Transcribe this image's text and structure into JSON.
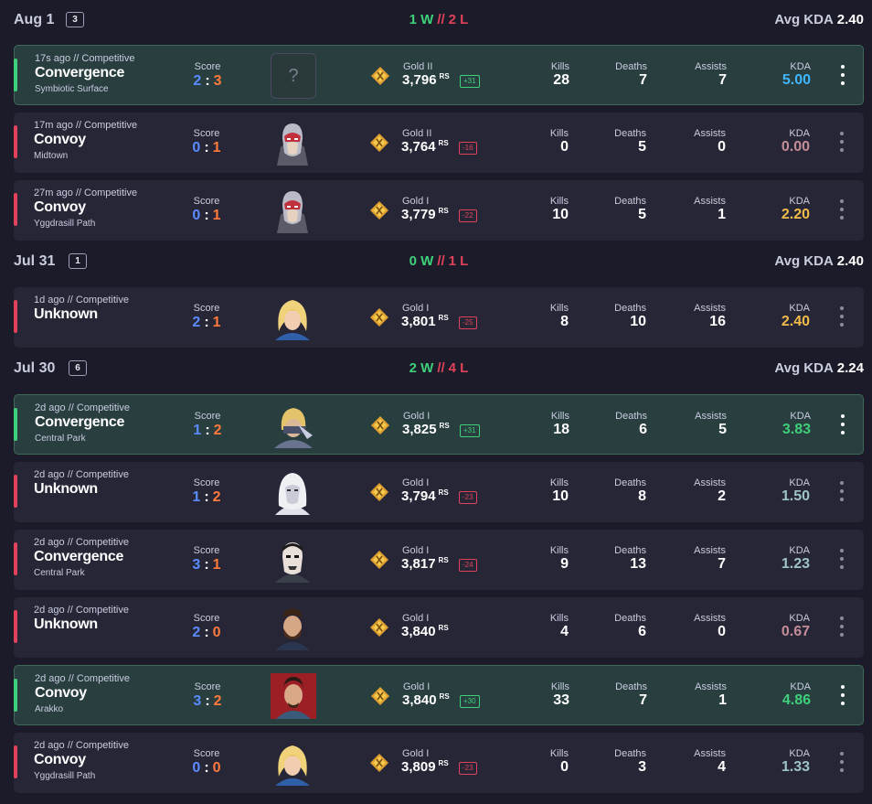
{
  "groups": [
    {
      "date": "Aug 1",
      "count": "3",
      "wins": "1 W",
      "sep": "//",
      "losses": "2 L",
      "avg_kda_label": "Avg KDA",
      "avg_kda": "2.40"
    },
    {
      "date": "Jul 31",
      "count": "1",
      "wins": "0 W",
      "sep": "//",
      "losses": "1 L",
      "avg_kda_label": "Avg KDA",
      "avg_kda": "2.40"
    },
    {
      "date": "Jul 30",
      "count": "6",
      "wins": "2 W",
      "sep": "//",
      "losses": "4 L",
      "avg_kda_label": "Avg KDA",
      "avg_kda": "2.24"
    }
  ],
  "labels": {
    "score": "Score",
    "kills": "Kills",
    "deaths": "Deaths",
    "assists": "Assists",
    "kda": "KDA",
    "rs": "RS",
    "unknown_hero": "?"
  },
  "matches": [
    {
      "meta": "17s ago  //  Competitive",
      "mode": "Convergence",
      "map": "Symbiotic Surface",
      "score_a": "2",
      "score_b": "3",
      "rank": "Gold II",
      "points": "3,796",
      "delta": "+31",
      "kills": "28",
      "deaths": "7",
      "assists": "7",
      "kda": "5.00",
      "kda_color": "#3fb7ff",
      "result": "win",
      "hero": "unknown"
    },
    {
      "meta": "17m ago  //  Competitive",
      "mode": "Convoy",
      "map": "Midtown",
      "score_a": "0",
      "score_b": "1",
      "rank": "Gold II",
      "points": "3,764",
      "delta": "-16",
      "kills": "0",
      "deaths": "5",
      "assists": "0",
      "kda": "0.00",
      "kda_color": "#c48d97",
      "result": "loss",
      "hero": "magneto"
    },
    {
      "meta": "27m ago  //  Competitive",
      "mode": "Convoy",
      "map": "Yggdrasill Path",
      "score_a": "0",
      "score_b": "1",
      "rank": "Gold I",
      "points": "3,779",
      "delta": "-22",
      "kills": "10",
      "deaths": "5",
      "assists": "1",
      "kda": "2.20",
      "kda_color": "#f1bb4a",
      "result": "loss",
      "hero": "magneto"
    },
    {
      "meta": "1d ago  //  Competitive",
      "mode": "Unknown",
      "map": "",
      "score_a": "2",
      "score_b": "1",
      "rank": "Gold I",
      "points": "3,801",
      "delta": "-25",
      "kills": "8",
      "deaths": "10",
      "assists": "16",
      "kda": "2.40",
      "kda_color": "#f1bb4a",
      "result": "loss",
      "hero": "invisible-woman"
    },
    {
      "meta": "2d ago  //  Competitive",
      "mode": "Convergence",
      "map": "Central Park",
      "score_a": "1",
      "score_b": "2",
      "rank": "Gold I",
      "points": "3,825",
      "delta": "+31",
      "kills": "18",
      "deaths": "6",
      "assists": "5",
      "kda": "3.83",
      "kda_color": "#3ed07a",
      "result": "win",
      "hero": "ninja"
    },
    {
      "meta": "2d ago  //  Competitive",
      "mode": "Unknown",
      "map": "",
      "score_a": "1",
      "score_b": "2",
      "rank": "Gold I",
      "points": "3,794",
      "delta": "-23",
      "kills": "10",
      "deaths": "8",
      "assists": "2",
      "kda": "1.50",
      "kda_color": "#9fc4c7",
      "result": "loss",
      "hero": "moon-knight"
    },
    {
      "meta": "2d ago  //  Competitive",
      "mode": "Convergence",
      "map": "Central Park",
      "score_a": "3",
      "score_b": "1",
      "rank": "Gold I",
      "points": "3,817",
      "delta": "-24",
      "kills": "9",
      "deaths": "13",
      "assists": "7",
      "kda": "1.23",
      "kda_color": "#9fc4c7",
      "result": "loss",
      "hero": "punisher"
    },
    {
      "meta": "2d ago  //  Competitive",
      "mode": "Unknown",
      "map": "",
      "score_a": "2",
      "score_b": "0",
      "rank": "Gold I",
      "points": "3,840",
      "delta": "",
      "kills": "4",
      "deaths": "6",
      "assists": "0",
      "kda": "0.67",
      "kda_color": "#c48d97",
      "result": "loss",
      "hero": "bearded"
    },
    {
      "meta": "2d ago  //  Competitive",
      "mode": "Convoy",
      "map": "Arakko",
      "score_a": "3",
      "score_b": "2",
      "rank": "Gold I",
      "points": "3,840",
      "delta": "+30",
      "kills": "33",
      "deaths": "7",
      "assists": "1",
      "kda": "4.86",
      "kda_color": "#3ed07a",
      "result": "win",
      "hero": "doctor-strange"
    },
    {
      "meta": "2d ago  //  Competitive",
      "mode": "Convoy",
      "map": "Yggdrasill Path",
      "score_a": "0",
      "score_b": "0",
      "rank": "Gold I",
      "points": "3,809",
      "delta": "-23",
      "kills": "0",
      "deaths": "3",
      "assists": "4",
      "kda": "1.33",
      "kda_color": "#9fc4c7",
      "result": "loss",
      "hero": "invisible-woman"
    }
  ]
}
